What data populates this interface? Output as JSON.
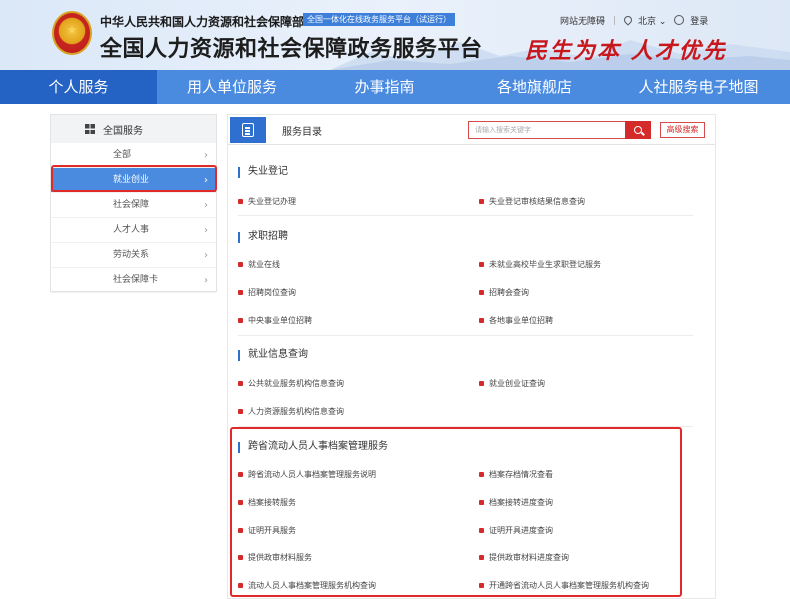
{
  "header": {
    "org_name": "中华人民共和国人力资源和社会保障部",
    "org_badge": "全国一体化在线政务服务平台（试运行）",
    "platform_title": "全国人力资源和社会保障政务服务平台",
    "slogan": "民生为本 人才优先",
    "accessibility": "网站无障碍",
    "location": "北京",
    "location_caret": "⌄",
    "login": "登录"
  },
  "nav": {
    "items": [
      {
        "label": "个人服务",
        "active": true
      },
      {
        "label": "用人单位服务",
        "active": false
      },
      {
        "label": "办事指南",
        "active": false
      },
      {
        "label": "各地旗舰店",
        "active": false
      },
      {
        "label": "人社服务电子地图",
        "active": false
      }
    ]
  },
  "sidebar": {
    "title": "全国服务",
    "items": [
      {
        "label": "全部",
        "active": false
      },
      {
        "label": "就业创业",
        "active": true
      },
      {
        "label": "社会保障",
        "active": false
      },
      {
        "label": "人才人事",
        "active": false
      },
      {
        "label": "劳动关系",
        "active": false
      },
      {
        "label": "社会保障卡",
        "active": false
      }
    ],
    "chevron": "›"
  },
  "content": {
    "title": "服务目录",
    "search_placeholder": "请输入搜索关键字",
    "advanced_search": "高级搜索",
    "sections": [
      {
        "title": "失业登记",
        "services": [
          "失业登记办理",
          "失业登记审核结果信息查询"
        ]
      },
      {
        "title": "求职招聘",
        "services": [
          "就业在线",
          "未就业高校毕业生求职登记服务",
          "招聘岗位查询",
          "招聘会查询",
          "中央事业单位招聘",
          "各地事业单位招聘"
        ]
      },
      {
        "title": "就业信息查询",
        "services": [
          "公共就业服务机构信息查询",
          "就业创业证查询",
          "人力资源服务机构信息查询"
        ]
      },
      {
        "title": "跨省流动人员人事档案管理服务",
        "services": [
          "跨省流动人员人事档案管理服务说明",
          "档案存档情况查看",
          "档案接转服务",
          "档案接转进度查询",
          "证明开具服务",
          "证明开具进度查询",
          "提供政审材料服务",
          "提供政审材料进度查询",
          "流动人员人事档案管理服务机构查询",
          "开通跨省流动人员人事档案管理服务机构查询"
        ]
      }
    ]
  },
  "colors": {
    "nav_bg": "#4a8be0",
    "nav_active": "#2463c3",
    "accent_red": "#d42a2a",
    "highlight_box": "#e02a2a"
  }
}
